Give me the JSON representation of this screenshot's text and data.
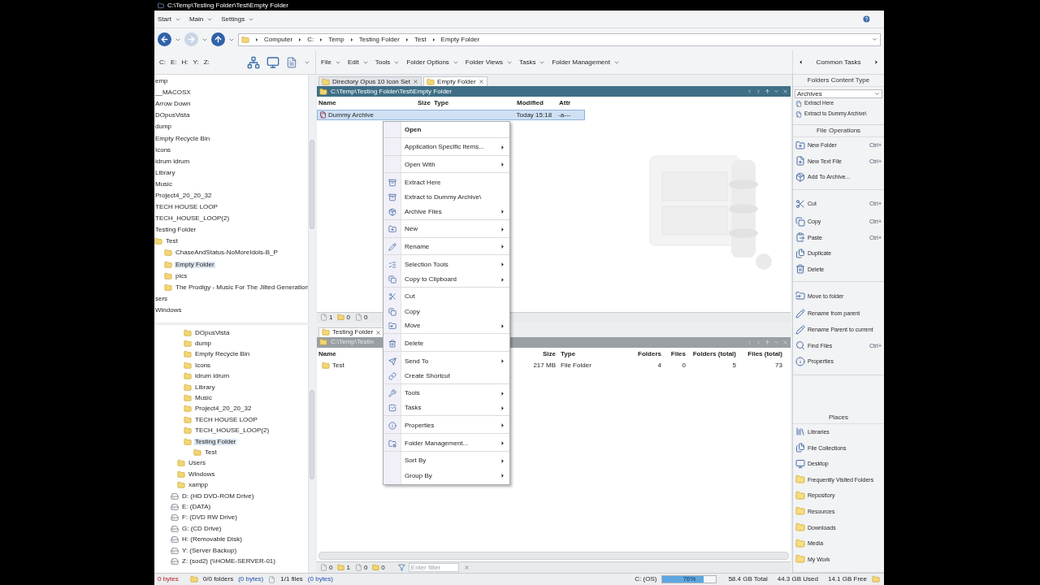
{
  "window": {
    "title": "C:\\Temp\\Testing Folder\\Test\\Empty Folder"
  },
  "menu_bar": [
    "Start",
    "Main",
    "Settings"
  ],
  "breadcrumb": [
    "Computer",
    "C:",
    "Temp",
    "Testing Folder",
    "Test",
    "Empty Folder"
  ],
  "drive_buttons": [
    "C:",
    "E:",
    "H:",
    "Y:",
    "Z:"
  ],
  "lister_menu": [
    "File",
    "Edit",
    "Tools",
    "Folder Options",
    "Folder Views",
    "Tasks",
    "Folder Management"
  ],
  "tree_top": [
    {
      "label": "emp",
      "selected": false
    },
    {
      "label": "__MACOSX",
      "selected": false
    },
    {
      "label": "Arrow Down",
      "selected": false
    },
    {
      "label": "DOpusVista",
      "selected": false
    },
    {
      "label": "dump",
      "selected": false
    },
    {
      "label": "Empty Recycle Bin",
      "selected": false
    },
    {
      "label": "Icons",
      "selected": false
    },
    {
      "label": "idrum idrum",
      "selected": false
    },
    {
      "label": "Library",
      "selected": false
    },
    {
      "label": "Music",
      "selected": false
    },
    {
      "label": "Project4_20_20_32",
      "selected": false
    },
    {
      "label": "TECH HOUSE LOOP",
      "selected": false
    },
    {
      "label": "TECH_HOUSE_LOOP(2)",
      "selected": false
    },
    {
      "label": "Testing Folder",
      "selected": false
    },
    {
      "label": "Test",
      "selected": false,
      "children": [
        {
          "label": "ChaseAndStatus-NoMoreIdols-B_P",
          "selected": false
        },
        {
          "label": "Empty Folder",
          "selected": true
        },
        {
          "label": "pics",
          "selected": false
        },
        {
          "label": "The Prodigy - Music For The Jilted Generation",
          "selected": false
        }
      ]
    },
    {
      "label": "sers",
      "selected": false
    },
    {
      "label": "Windows",
      "selected": false
    }
  ],
  "tree_bottom": [
    {
      "kind": "subfolder",
      "label": "DOpusVista",
      "selected": false
    },
    {
      "kind": "subfolder",
      "label": "dump",
      "selected": false
    },
    {
      "kind": "subfolder",
      "label": "Empty Recycle Bin",
      "selected": false
    },
    {
      "kind": "subfolder",
      "label": "Icons",
      "selected": false
    },
    {
      "kind": "subfolder",
      "label": "idrum idrum",
      "selected": false
    },
    {
      "kind": "subfolder",
      "label": "Library",
      "selected": false
    },
    {
      "kind": "subfolder",
      "label": "Music",
      "selected": false
    },
    {
      "kind": "subfolder",
      "label": "Project4_20_20_32",
      "selected": false
    },
    {
      "kind": "subfolder",
      "label": "TECH HOUSE LOOP",
      "selected": false
    },
    {
      "kind": "subfolder",
      "label": "TECH_HOUSE_LOOP(2)",
      "selected": false
    },
    {
      "kind": "subfolder",
      "label": "Testing Folder",
      "selected": true,
      "children": [
        {
          "label": "Test",
          "selected": false
        }
      ]
    },
    {
      "kind": "folder",
      "label": "Users",
      "selected": false
    },
    {
      "kind": "folder",
      "label": "Windows",
      "selected": false
    },
    {
      "kind": "folder",
      "label": "xampp",
      "selected": false
    },
    {
      "kind": "drive",
      "label": "D: (HD DVD-ROM Drive)",
      "selected": false
    },
    {
      "kind": "drive",
      "label": "E: (DATA)",
      "selected": false
    },
    {
      "kind": "drive",
      "label": "F: (DVD RW Drive)",
      "selected": false
    },
    {
      "kind": "drive",
      "label": "G: (CD Drive)",
      "selected": false
    },
    {
      "kind": "drive",
      "label": "H: (Removable Disk)",
      "selected": false
    },
    {
      "kind": "drive",
      "label": "Y: (Server Backup)",
      "selected": false
    },
    {
      "kind": "drive",
      "label": "Z: (sod2) (\\\\HOME-SERVER-01)",
      "selected": false
    }
  ],
  "lister_top": {
    "tabs": [
      {
        "label": "Directory Opus 10 Icon Set",
        "selected": false
      },
      {
        "label": "Empty Folder",
        "selected": true
      }
    ],
    "path": "C:\\Temp\\Testing Folder\\Test\\Empty Folder",
    "columns": [
      "Name",
      "Size",
      "Type",
      "Modified",
      "Attr"
    ],
    "rows": [
      {
        "cells": [
          "Dummy Archive",
          null,
          null,
          "Today  15:18",
          "-a---"
        ],
        "selected": true
      }
    ],
    "counts": [
      "1",
      "0",
      "0"
    ]
  },
  "lister_bottom": {
    "tabs": [
      {
        "label": "Testing Folder",
        "selected": true
      }
    ],
    "path": "C:\\Temp\\Testin",
    "columns": [
      "Name",
      "Size",
      "Type",
      "Folders",
      "Files",
      "Folders (total)",
      "Files (total)"
    ],
    "rows": [
      {
        "cells": [
          "Test",
          "217 MB",
          "File Folder",
          "4",
          "0",
          "5",
          "73"
        ]
      }
    ],
    "counts": [
      "0",
      "1",
      "0",
      "0"
    ],
    "filter": {
      "placeholder": "Enter filter"
    }
  },
  "context_menu": [
    {
      "label": "Open",
      "default": true,
      "submenu": false,
      "separator_before": false
    },
    {
      "label": "Application Specific Items...",
      "default": false,
      "submenu": true,
      "separator_before": true
    },
    {
      "label": "Open With",
      "default": false,
      "submenu": true,
      "separator_before": true
    },
    {
      "label": "Extract Here",
      "default": false,
      "submenu": false,
      "separator_before": true
    },
    {
      "label": "Extract to Dummy Archive\\",
      "default": false,
      "submenu": false,
      "separator_before": false
    },
    {
      "label": "Archive Files",
      "default": false,
      "submenu": true,
      "separator_before": false
    },
    {
      "label": "New",
      "default": false,
      "submenu": true,
      "separator_before": true
    },
    {
      "label": "Rename",
      "default": false,
      "submenu": true,
      "separator_before": true
    },
    {
      "label": "Selection Tools",
      "default": false,
      "submenu": true,
      "separator_before": true
    },
    {
      "label": "Copy to Clipboard",
      "default": false,
      "submenu": true,
      "separator_before": false
    },
    {
      "label": "Cut",
      "default": false,
      "submenu": false,
      "separator_before": true
    },
    {
      "label": "Copy",
      "default": false,
      "submenu": false,
      "separator_before": false
    },
    {
      "label": "Move",
      "default": false,
      "submenu": true,
      "separator_before": false
    },
    {
      "label": "Delete",
      "default": false,
      "submenu": false,
      "separator_before": true
    },
    {
      "label": "Send To",
      "default": false,
      "submenu": true,
      "separator_before": true
    },
    {
      "label": "Create Shortcut",
      "default": false,
      "submenu": false,
      "separator_before": false
    },
    {
      "label": "Tools",
      "default": false,
      "submenu": true,
      "separator_before": true
    },
    {
      "label": "Tasks",
      "default": false,
      "submenu": true,
      "separator_before": false
    },
    {
      "label": "Properties",
      "default": false,
      "submenu": true,
      "separator_before": true
    },
    {
      "label": "Folder Management...",
      "default": false,
      "submenu": true,
      "separator_before": true
    },
    {
      "label": "Sort By",
      "default": false,
      "submenu": true,
      "separator_before": true
    },
    {
      "label": "Group By",
      "default": false,
      "submenu": true,
      "separator_before": false
    }
  ],
  "side_panel": {
    "title": "Common Tasks",
    "sections": [
      {
        "title": "Folders Content Type",
        "dropdown": "Archives",
        "items": [
          {
            "label": "Extract Here"
          },
          {
            "label": "Extract to Dummy Archive\\"
          }
        ]
      },
      {
        "title": "File Operations",
        "items": [
          {
            "label": "New Folder",
            "shortcut": "Ctrl+"
          },
          {
            "label": "New Text File",
            "shortcut": "Ctrl+"
          },
          {
            "label": "Add To Archive..."
          },
          {
            "label": "Cut",
            "shortcut": "Ctrl+",
            "separator_before": true
          },
          {
            "label": "Copy",
            "shortcut": "Ctrl+"
          },
          {
            "label": "Paste",
            "shortcut": "Ctrl+"
          },
          {
            "label": "Duplicate"
          },
          {
            "label": "Delete"
          },
          {
            "label": "Move to folder",
            "separator_before": true
          },
          {
            "label": "Rename from parent"
          },
          {
            "label": "Rename Parent to current"
          },
          {
            "label": "Find Files",
            "shortcut": "Ctrl+"
          },
          {
            "label": "Properties"
          }
        ]
      },
      {
        "title": "Places",
        "items": [
          {
            "label": "Libraries"
          },
          {
            "label": "File Collections"
          },
          {
            "label": "Desktop"
          },
          {
            "label": "Frequently Visited Folders"
          },
          {
            "label": "Repository"
          },
          {
            "label": "Resources"
          },
          {
            "label": "Downloads"
          },
          {
            "label": "Media"
          },
          {
            "label": "My Work"
          }
        ]
      }
    ]
  },
  "status_bar": {
    "selected_size": "0 bytes",
    "folders": "0/0 folders",
    "folders_size": "(0 bytes)",
    "files": "1/1 files",
    "files_size": "(0 bytes)",
    "drive": "C: (OS)",
    "usage": {
      "level": 0.76,
      "reading": "76%"
    },
    "total": "58.4 GB Total",
    "used": "44.3 GB Used",
    "free": "14.1 GB Free"
  }
}
